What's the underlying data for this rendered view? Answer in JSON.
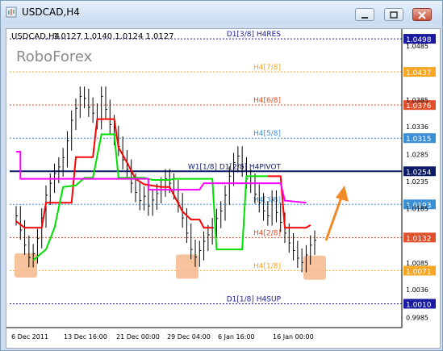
{
  "window": {
    "title": "USDCAD,H4",
    "buttons": [
      "minimize",
      "maximize",
      "close"
    ]
  },
  "chart_header": {
    "symbol_tf": "USDCAD,H4",
    "ohlc": "1.0127 1.0140 1.0124 1.0127",
    "watermark": "RoboForex"
  },
  "colors": {
    "murrey_dark": "#1a1aa0",
    "murrey_orange": "#f5a623",
    "murrey_red": "#e0502a",
    "murrey_blue": "#3b8fd6",
    "pivot_navy": "#0b1a66",
    "price_bars": "#000000",
    "stop_red": "#ff0000",
    "stop_green": "#00e000",
    "pivot_magenta": "#ff00ff",
    "arrow": "#f08a28",
    "highlight": "#f4b88c"
  },
  "chart_data": {
    "type": "line",
    "price_labels": [
      "1.0498",
      "1.0485",
      "1.0437",
      "1.0385",
      "1.0376",
      "1.0336",
      "1.0315",
      "1.0285",
      "1.0254",
      "1.0235",
      "1.0193",
      "1.0185",
      "1.0132",
      "1.0085",
      "1.0071",
      "1.0036",
      "1.0010",
      "0.9985"
    ],
    "x_labels": [
      "6 Dec 2011",
      "13 Dec 16:00",
      "21 Dec 00:00",
      "29 Dec 04:00",
      "6 Jan 16:00",
      "16 Jan 00:00"
    ],
    "levels": [
      {
        "label": "D1[3/8] H4RES",
        "value": 1.0498,
        "box": "1.0498",
        "style": "murrey_dark"
      },
      {
        "label": "H4[7/8]",
        "value": 1.0437,
        "box": "1.0437",
        "style": "murrey_orange"
      },
      {
        "label": "H4[6/8]",
        "value": 1.0376,
        "box": "1.0376",
        "style": "murrey_red"
      },
      {
        "label": "H4[5/8]",
        "value": 1.0315,
        "box": "1.0315",
        "style": "murrey_blue"
      },
      {
        "label": "W1[1/8] D1[2/8] H4PIVOT",
        "value": 1.0254,
        "box": "1.0254",
        "style": "pivot_navy"
      },
      {
        "label": "H4[3/8]",
        "value": 1.0193,
        "box": "1.0193",
        "style": "murrey_blue"
      },
      {
        "label": "H4[2/8]",
        "value": 1.0132,
        "box": "1.0132",
        "style": "murrey_red"
      },
      {
        "label": "H4[1/8]",
        "value": 1.0071,
        "box": "1.0071",
        "style": "murrey_orange"
      },
      {
        "label": "D1[1/8] H4SUP",
        "value": 1.001,
        "box": "1.0010",
        "style": "murrey_dark"
      }
    ],
    "price_series": [
      1.0172,
      1.0146,
      1.0118,
      1.0095,
      1.0102,
      1.013,
      1.0168,
      1.021,
      1.0232,
      1.025,
      1.0262,
      1.0279,
      1.031,
      1.0348,
      1.037,
      1.0392,
      1.0388,
      1.0372,
      1.0361,
      1.0349,
      1.0392,
      1.0368,
      1.034,
      1.032,
      1.03,
      1.0275,
      1.0258,
      1.0232,
      1.0215,
      1.02,
      1.0208,
      1.019,
      1.0201,
      1.0213,
      1.0225,
      1.024,
      1.0232,
      1.022,
      1.0196,
      1.0168,
      1.014,
      1.011,
      1.0096,
      1.0108,
      1.0125,
      1.0137,
      1.015,
      1.0167,
      1.0181,
      1.021,
      1.0245,
      1.027,
      1.0282,
      1.0262,
      1.024,
      1.0232,
      1.0212,
      1.0196,
      1.0181,
      1.0172,
      1.0201,
      1.0178,
      1.016,
      1.014,
      1.0122,
      1.0108,
      1.0094,
      1.0086,
      1.01,
      1.0118,
      1.0127
    ],
    "stop_series": [
      {
        "color": "stop_red",
        "segments": [
          [
            0,
            1.0162
          ],
          [
            2,
            1.015
          ],
          [
            6,
            1.015
          ],
          [
            7,
            1.0196
          ],
          [
            13,
            1.0196
          ],
          [
            14,
            1.028
          ],
          [
            18,
            1.028
          ],
          [
            19,
            1.035
          ],
          [
            23,
            1.035
          ],
          [
            24,
            1.0298
          ],
          [
            26,
            1.027
          ],
          [
            28,
            1.024
          ],
          [
            30,
            1.023
          ],
          [
            34,
            1.0225
          ],
          [
            36,
            1.0225
          ],
          [
            37,
            1.021
          ],
          [
            39,
            1.018
          ],
          [
            41,
            1.0165
          ],
          [
            43,
            1.0165
          ],
          [
            44,
            1.015
          ],
          [
            46,
            1.015
          ]
        ]
      },
      {
        "color": "stop_green",
        "segments": [
          [
            4,
            1.009
          ],
          [
            7,
            1.011
          ],
          [
            9,
            1.015
          ],
          [
            11,
            1.0225
          ],
          [
            14,
            1.0228
          ],
          [
            16,
            1.0242
          ],
          [
            18,
            1.0242
          ],
          [
            20,
            1.0322
          ],
          [
            23,
            1.0322
          ],
          [
            24,
            1.0242
          ],
          [
            30,
            1.0242
          ],
          [
            32,
            1.0238
          ],
          [
            36,
            1.0238
          ],
          [
            37,
            1.024
          ],
          [
            46,
            1.024
          ],
          [
            47,
            1.011
          ],
          [
            53,
            1.011
          ],
          [
            54,
            1.0245
          ],
          [
            59,
            1.0245
          ]
        ]
      },
      {
        "color": "stop_red",
        "segments": [
          [
            59,
            1.0245
          ],
          [
            62,
            1.0245
          ],
          [
            63,
            1.015
          ],
          [
            68,
            1.015
          ],
          [
            69,
            1.0155
          ]
        ]
      },
      {
        "color": "pivot_magenta",
        "segments": [
          [
            0,
            1.029
          ],
          [
            1,
            1.029
          ],
          [
            1,
            1.024
          ],
          [
            31,
            1.024
          ],
          [
            31,
            1.022
          ],
          [
            43,
            1.022
          ],
          [
            44,
            1.0232
          ],
          [
            62,
            1.0232
          ],
          [
            63,
            1.02
          ],
          [
            68,
            1.0196
          ]
        ]
      }
    ],
    "annotation": "upward arrow",
    "highlight_count": 3
  }
}
